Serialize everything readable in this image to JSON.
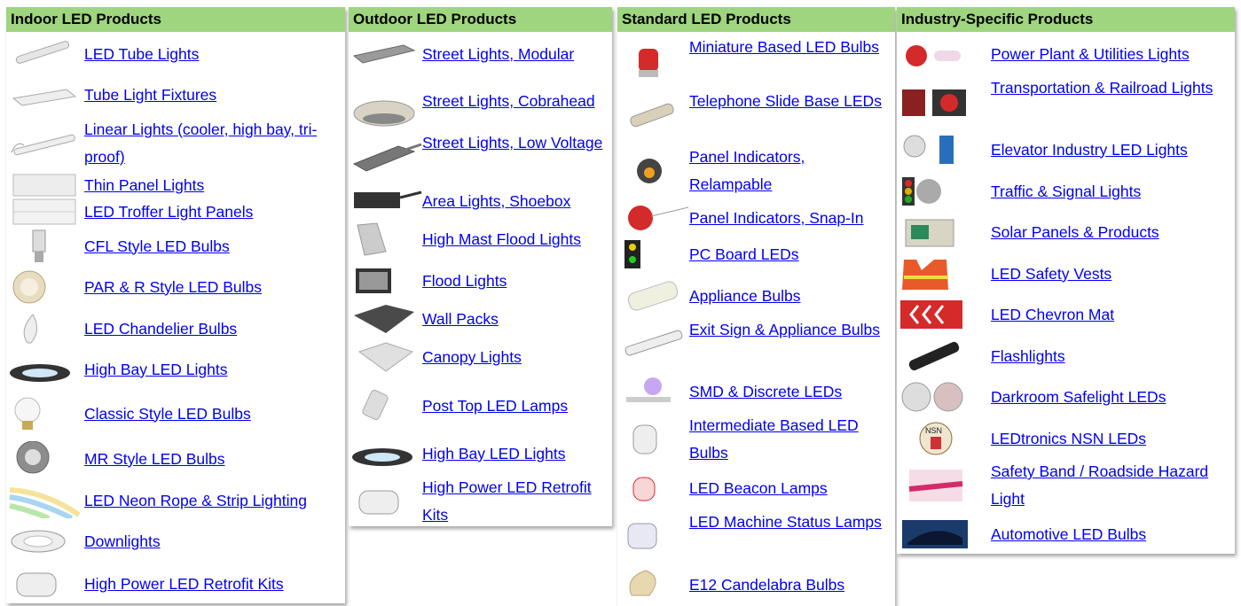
{
  "colors": {
    "header_bg": "#9fd57e",
    "link": "#0000ee"
  },
  "columns": [
    {
      "title": "Indoor LED Products",
      "items": [
        {
          "label": "LED Tube Lights",
          "icon": "tube-light-icon"
        },
        {
          "label": "Tube Light Fixtures",
          "icon": "fixture-icon"
        },
        {
          "label": "Linear Lights (cooler, high bay, tri-proof)",
          "icon": "linear-light-icon"
        },
        {
          "label": "Thin Panel Lights",
          "icon": "panel-icon"
        },
        {
          "label": "LED Troffer Light Panels",
          "icon": "troffer-icon"
        },
        {
          "label": "CFL Style LED Bulbs",
          "icon": "cfl-bulb-icon"
        },
        {
          "label": "PAR & R Style LED Bulbs",
          "icon": "par-bulb-icon"
        },
        {
          "label": "LED Chandelier Bulbs",
          "icon": "chandelier-bulb-icon"
        },
        {
          "label": "High Bay LED Lights",
          "icon": "high-bay-icon"
        },
        {
          "label": "Classic Style LED Bulbs",
          "icon": "classic-bulb-icon"
        },
        {
          "label": "MR Style LED Bulbs",
          "icon": "mr-bulb-icon"
        },
        {
          "label": "LED Neon Rope & Strip Lighting",
          "icon": "neon-strip-icon"
        },
        {
          "label": "Downlights",
          "icon": "downlight-icon"
        },
        {
          "label": "High Power LED Retrofit Kits",
          "icon": "retrofit-kit-icon"
        }
      ]
    },
    {
      "title": "Outdoor LED Products",
      "items": [
        {
          "label": "Street Lights, Modular",
          "icon": "street-light-icon"
        },
        {
          "label": "Street Lights, Cobrahead",
          "icon": "cobrahead-icon"
        },
        {
          "label": "Street Lights, Low Voltage",
          "icon": "low-voltage-street-icon"
        },
        {
          "label": "Area Lights, Shoebox",
          "icon": "shoebox-icon"
        },
        {
          "label": "High Mast Flood Lights",
          "icon": "high-mast-icon"
        },
        {
          "label": "Flood Lights",
          "icon": "flood-light-icon"
        },
        {
          "label": "Wall Packs",
          "icon": "wall-pack-icon"
        },
        {
          "label": "Canopy Lights",
          "icon": "canopy-icon"
        },
        {
          "label": "Post Top LED Lamps",
          "icon": "post-top-icon"
        },
        {
          "label": "High Bay LED Lights",
          "icon": "high-bay-icon"
        },
        {
          "label": "High Power LED Retrofit Kits",
          "icon": "retrofit-kit-icon"
        }
      ]
    },
    {
      "title": "Standard LED Products",
      "items": [
        {
          "label": "Miniature Based LED Bulbs",
          "icon": "miniature-bulb-icon"
        },
        {
          "label": "Telephone Slide Base LEDs",
          "icon": "slide-base-icon"
        },
        {
          "label": "Panel Indicators, Relampable",
          "icon": "panel-indicator-icon"
        },
        {
          "label": "Panel Indicators, Snap-In",
          "icon": "snap-in-indicator-icon"
        },
        {
          "label": "PC Board LEDs",
          "icon": "pc-board-icon"
        },
        {
          "label": "Appliance Bulbs",
          "icon": "appliance-bulb-icon"
        },
        {
          "label": "Exit Sign & Appliance Bulbs",
          "icon": "exit-sign-bulb-icon"
        },
        {
          "label": "SMD & Discrete LEDs",
          "icon": "smd-led-icon"
        },
        {
          "label": "Intermediate Based LED Bulbs",
          "icon": "intermediate-bulb-icon"
        },
        {
          "label": "LED Beacon Lamps",
          "icon": "beacon-lamp-icon"
        },
        {
          "label": "LED Machine Status Lamps",
          "icon": "machine-status-icon"
        },
        {
          "label": "E12 Candelabra Bulbs",
          "icon": "candelabra-bulb-icon"
        }
      ]
    },
    {
      "title": "Industry-Specific Products",
      "items": [
        {
          "label": "Power Plant & Utilities Lights",
          "icon": "power-plant-icon"
        },
        {
          "label": "Transportation & Railroad Lights",
          "icon": "railroad-icon"
        },
        {
          "label": "Elevator Industry LED Lights",
          "icon": "elevator-icon"
        },
        {
          "label": "Traffic & Signal Lights",
          "icon": "traffic-signal-icon"
        },
        {
          "label": "Solar Panels & Products",
          "icon": "solar-panel-icon"
        },
        {
          "label": "LED Safety Vests",
          "icon": "safety-vest-icon"
        },
        {
          "label": "LED Chevron Mat",
          "icon": "chevron-mat-icon"
        },
        {
          "label": "Flashlights",
          "icon": "flashlight-icon"
        },
        {
          "label": "Darkroom Safelight LEDs",
          "icon": "safelight-icon"
        },
        {
          "label": "LEDtronics NSN LEDs",
          "icon": "nsn-seal-icon"
        },
        {
          "label": "Safety Band / Roadside Hazard Light",
          "icon": "safety-band-icon"
        },
        {
          "label": "Automotive LED Bulbs",
          "icon": "automotive-icon"
        }
      ]
    }
  ]
}
